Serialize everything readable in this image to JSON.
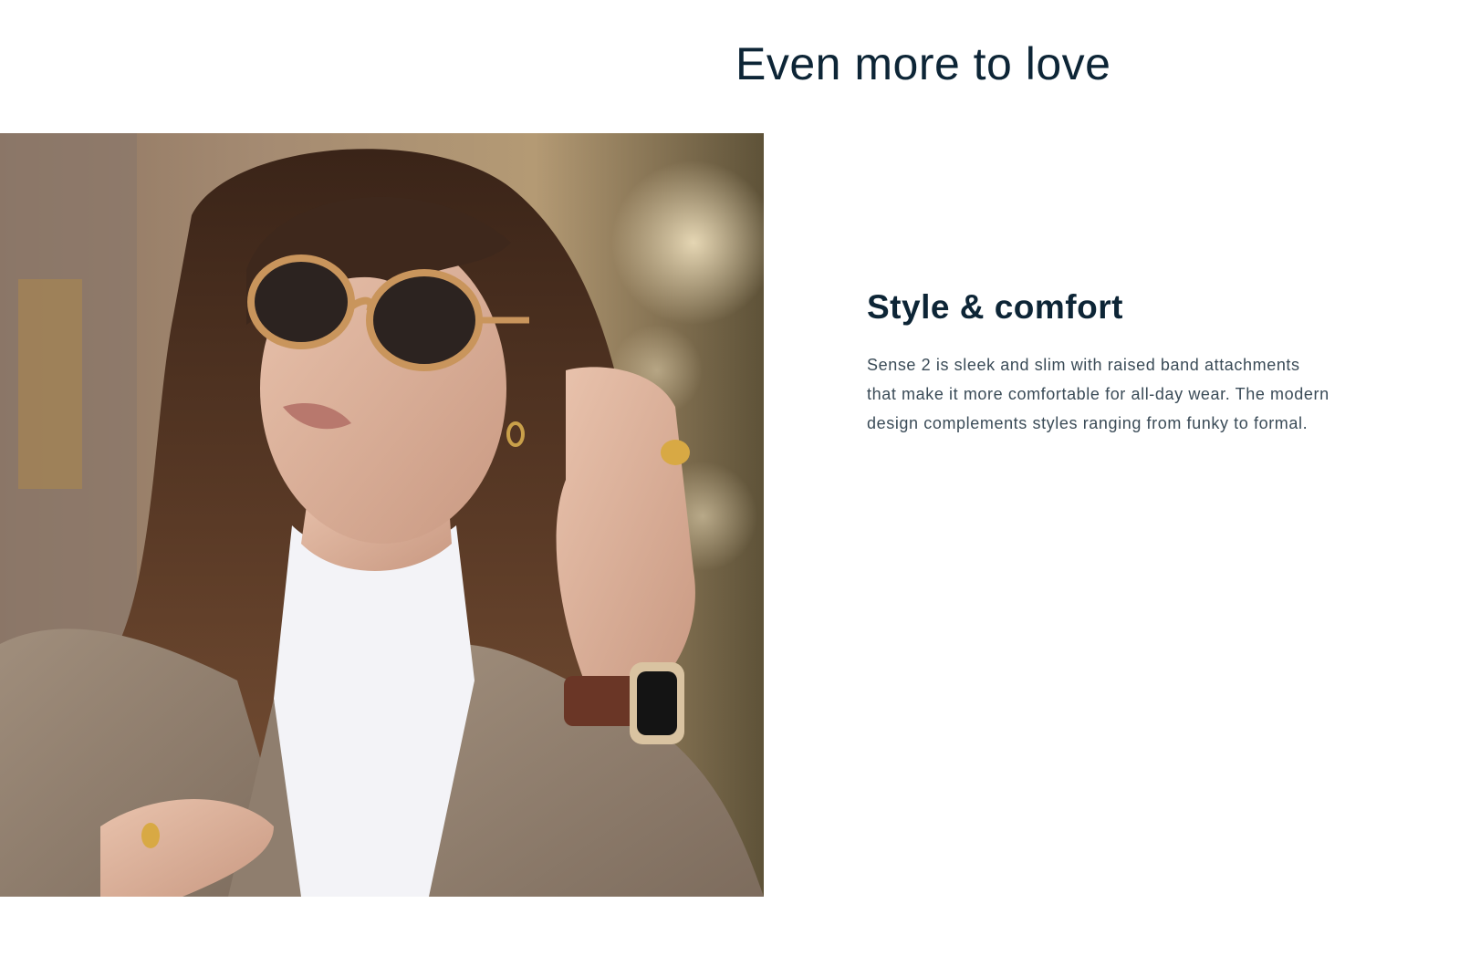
{
  "section": {
    "title": "Even more to love"
  },
  "feature": {
    "title": "Style & comfort",
    "body": "Sense 2 is sleek and slim with raised band attachments that make it more comfortable for all-day wear. The modern design complements styles ranging from funky to formal."
  },
  "photo": {
    "subject": "woman-with-sunglasses-wearing-smartwatch-photo"
  },
  "colors": {
    "heading": "#0d2536",
    "body_text": "#3a4b57",
    "background": "#ffffff"
  }
}
